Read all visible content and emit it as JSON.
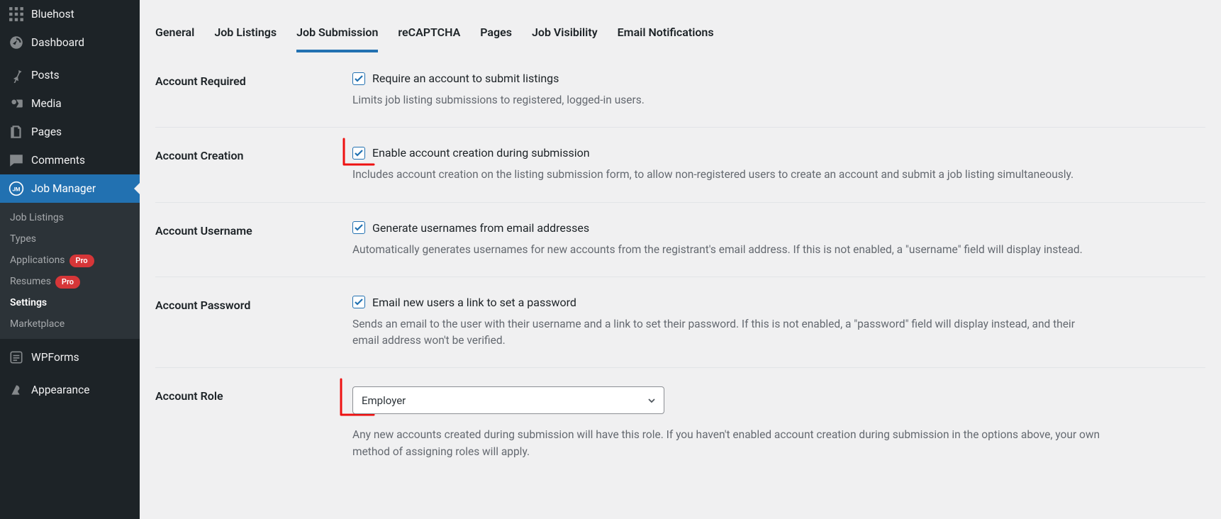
{
  "sidebar": {
    "items": [
      {
        "label": "Bluehost"
      },
      {
        "label": "Dashboard"
      },
      {
        "label": "Posts"
      },
      {
        "label": "Media"
      },
      {
        "label": "Pages"
      },
      {
        "label": "Comments"
      },
      {
        "label": "Job Manager"
      },
      {
        "label": "WPForms"
      },
      {
        "label": "Appearance"
      }
    ],
    "jobmanager_submenu": [
      {
        "label": "Job Listings"
      },
      {
        "label": "Types"
      },
      {
        "label": "Applications",
        "pro": "Pro"
      },
      {
        "label": "Resumes",
        "pro": "Pro"
      },
      {
        "label": "Settings"
      },
      {
        "label": "Marketplace"
      }
    ]
  },
  "tabs": [
    {
      "label": "General"
    },
    {
      "label": "Job Listings"
    },
    {
      "label": "Job Submission"
    },
    {
      "label": "reCAPTCHA"
    },
    {
      "label": "Pages"
    },
    {
      "label": "Job Visibility"
    },
    {
      "label": "Email Notifications"
    }
  ],
  "settings": {
    "account_required": {
      "title": "Account Required",
      "checkbox_label": "Require an account to submit listings",
      "desc": "Limits job listing submissions to registered, logged-in users."
    },
    "account_creation": {
      "title": "Account Creation",
      "checkbox_label": "Enable account creation during submission",
      "desc": "Includes account creation on the listing submission form, to allow non-registered users to create an account and submit a job listing simultaneously."
    },
    "account_username": {
      "title": "Account Username",
      "checkbox_label": "Generate usernames from email addresses",
      "desc": "Automatically generates usernames for new accounts from the registrant's email address. If this is not enabled, a \"username\" field will display instead."
    },
    "account_password": {
      "title": "Account Password",
      "checkbox_label": "Email new users a link to set a password",
      "desc": "Sends an email to the user with their username and a link to set their password. If this is not enabled, a \"password\" field will display instead, and their email address won't be verified."
    },
    "account_role": {
      "title": "Account Role",
      "selected": "Employer",
      "desc": "Any new accounts created during submission will have this role. If you haven't enabled account creation during submission in the options above, your own method of assigning roles will apply."
    }
  }
}
